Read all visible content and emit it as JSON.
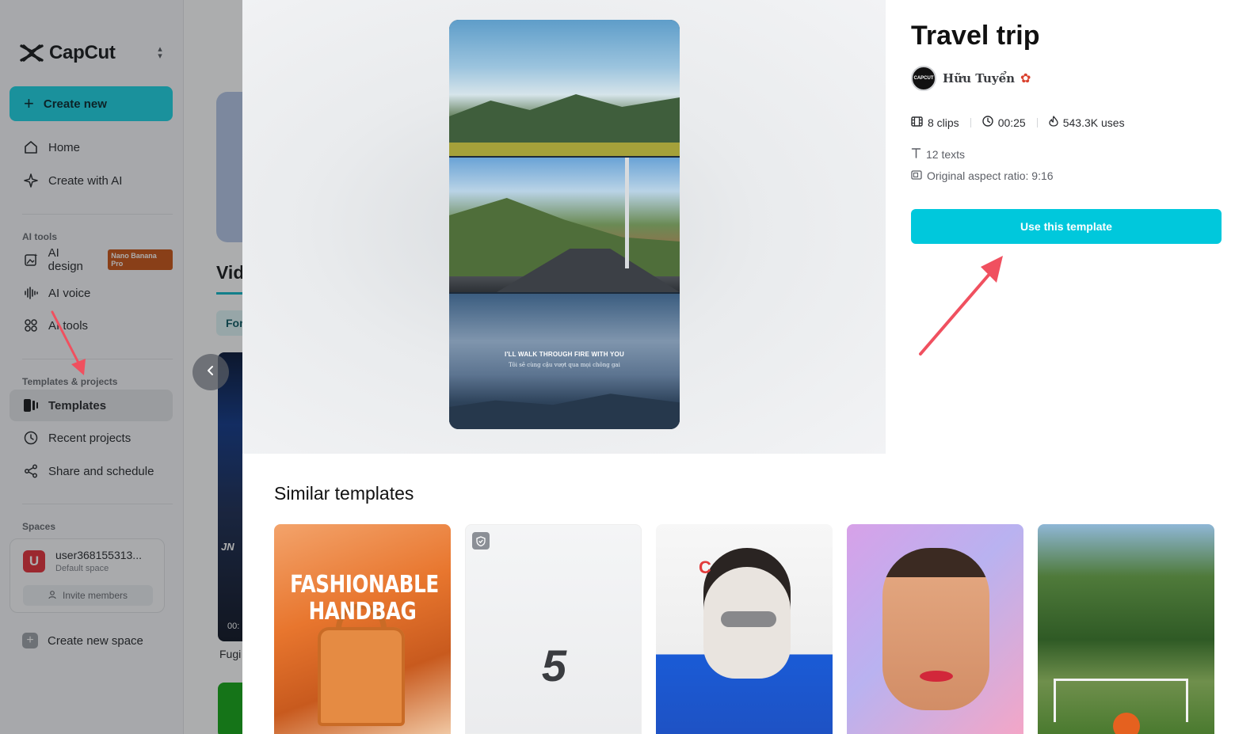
{
  "app": {
    "name": "CapCut"
  },
  "sidebar": {
    "create_label": "Create new",
    "nav_top": [
      {
        "label": "Home",
        "icon": "home-icon"
      },
      {
        "label": "Create with AI",
        "icon": "sparkle-icon"
      }
    ],
    "ai_tools_title": "AI tools",
    "ai_tools": [
      {
        "label": "AI design",
        "badge": "Nano Banana Pro",
        "icon": "image-edit-icon"
      },
      {
        "label": "AI voice",
        "icon": "waveform-icon"
      },
      {
        "label": "AI tools",
        "icon": "grid-icon"
      }
    ],
    "templates_title": "Templates & projects",
    "templates_nav": [
      {
        "label": "Templates",
        "icon": "template-icon",
        "active": true
      },
      {
        "label": "Recent projects",
        "icon": "clock-icon"
      },
      {
        "label": "Share and schedule",
        "icon": "share-icon"
      }
    ],
    "spaces_title": "Spaces",
    "space": {
      "avatar_letter": "U",
      "name": "user368155313...",
      "subtitle": "Default space",
      "invite_label": "Invite members"
    },
    "new_space_label": "Create new space"
  },
  "background_page": {
    "section_heading": "Vid",
    "chip_label": "For",
    "thumb_badge": "JN",
    "thumb_time": "00:",
    "thumb_title": "Fugi"
  },
  "template": {
    "title": "Travel trip",
    "author": {
      "name": "Hữu Tuyển",
      "avatar_text": "CAPCUT"
    },
    "clips": "8 clips",
    "duration": "00:25",
    "uses": "543.3K uses",
    "texts": "12 texts",
    "aspect_ratio": "Original aspect ratio: 9:16",
    "use_button": "Use this template",
    "preview_caption_main": "I'LL WALK THROUGH FIRE WITH YOU",
    "preview_caption_sub": "Tôi sẽ cùng cậu vượt qua mọi chông gai"
  },
  "similar": {
    "title": "Similar templates",
    "cards": [
      {
        "text": "FASHIONABLE HANDBAG"
      },
      {
        "text": "5"
      },
      {
        "text": "C"
      },
      {
        "text": ""
      },
      {
        "text": ""
      }
    ]
  },
  "colors": {
    "accent": "#00c8dc",
    "annotation_arrow": "#f0505f"
  }
}
